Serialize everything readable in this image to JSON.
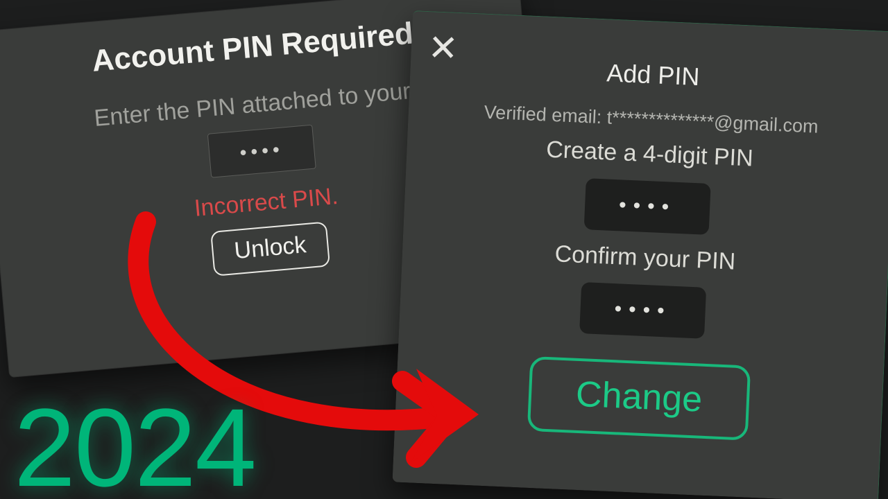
{
  "overlay": {
    "year": "2024"
  },
  "dialog1": {
    "title": "Account PIN Required",
    "subtitle": "Enter the PIN attached to your ac",
    "pin_mask": "••••",
    "error": "Incorrect PIN.",
    "unlock_label": "Unlock"
  },
  "dialog2": {
    "title": "Add PIN",
    "email_line": "Verified email: t**************@gmail.com",
    "create_label": "Create a 4-digit PIN",
    "create_mask": "••••",
    "confirm_label": "Confirm your PIN",
    "confirm_mask": "••••",
    "change_label": "Change"
  },
  "colors": {
    "accent_green": "#1cca87",
    "error_red": "#d94a4a",
    "panel": "#3a3c3a",
    "bg": "#1d1e1e"
  }
}
